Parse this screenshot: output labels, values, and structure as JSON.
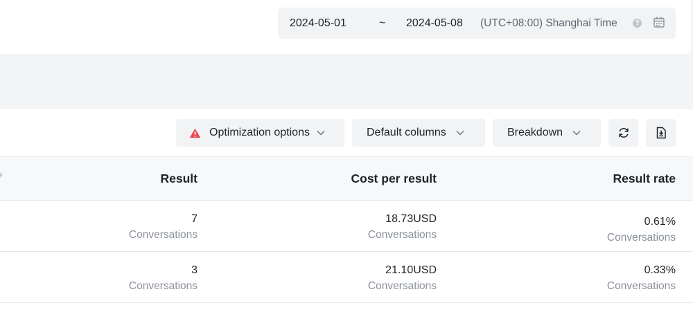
{
  "date_range": {
    "start": "2024-05-01",
    "separator": "~",
    "end": "2024-05-08",
    "timezone": "(UTC+08:00) Shanghai Time",
    "help_icon": "question-circle-icon",
    "calendar_icon": "calendar-icon"
  },
  "toolbar": {
    "optimization_label": "Optimization options",
    "optimization_icon": "warning-triangle-icon",
    "warning_color": "#e5484d",
    "columns_label": "Default columns",
    "breakdown_label": "Breakdown",
    "refresh_icon": "refresh-icon",
    "export_icon": "export-icon"
  },
  "table": {
    "columns": [
      "Result",
      "Cost per result",
      "Result rate"
    ],
    "rows": [
      {
        "result": "7",
        "result_sub": "Conversations",
        "cost": "18.73USD",
        "cost_sub": "Conversations",
        "rate": "0.61%",
        "rate_sub": "Conversations"
      },
      {
        "result": "3",
        "result_sub": "Conversations",
        "cost": "21.10USD",
        "cost_sub": "Conversations",
        "rate": "0.33%",
        "rate_sub": "Conversations"
      }
    ]
  }
}
